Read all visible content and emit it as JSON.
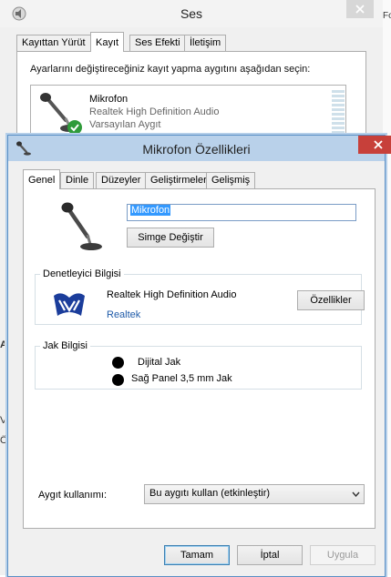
{
  "ses_window": {
    "title": "Ses",
    "icon": "speaker-icon",
    "tabs": [
      "Kayıttan Yürüt",
      "Kayıt",
      "Ses Efekti",
      "İletişim"
    ],
    "active_tab": "Kayıt",
    "instruction": "Ayarlarını değiştireceğiniz kayıt yapma aygıtını aşağıdan seçin:",
    "device": {
      "name": "Mikrofon",
      "driver": "Realtek High Definition Audio",
      "status": "Varsayılan Aygıt",
      "status_icon": "green-check-icon"
    },
    "clipped_right_text": "Fo",
    "clipped_left_letters": [
      "A",
      "V",
      "Ö"
    ]
  },
  "dialog": {
    "title": "Mikrofon Özellikleri",
    "icon": "microphone-icon",
    "tabs": [
      "Genel",
      "Dinle",
      "Düzeyler",
      "Geliştirmeler",
      "Gelişmiş"
    ],
    "active_tab": "Genel",
    "device_name_value": "Mikrofon",
    "change_icon_button": "Simge Değiştir",
    "controller": {
      "legend": "Denetleyici Bilgisi",
      "name": "Realtek High Definition Audio",
      "vendor_link": "Realtek",
      "properties_button": "Özellikler"
    },
    "jack": {
      "legend": "Jak Bilgisi",
      "items": [
        "Dijital Jak",
        "Sağ Panel 3,5 mm Jak"
      ]
    },
    "usage": {
      "label": "Aygıt kullanımı:",
      "selected": "Bu aygıtı kullan (etkinleştir)"
    },
    "buttons": {
      "ok": "Tamam",
      "cancel": "İptal",
      "apply": "Uygula"
    }
  },
  "colors": {
    "dialog_titlebar": "#b9d1ea",
    "close_red": "#c7403a",
    "selection_blue": "#3399ff",
    "link_blue": "#1e5aa8"
  }
}
